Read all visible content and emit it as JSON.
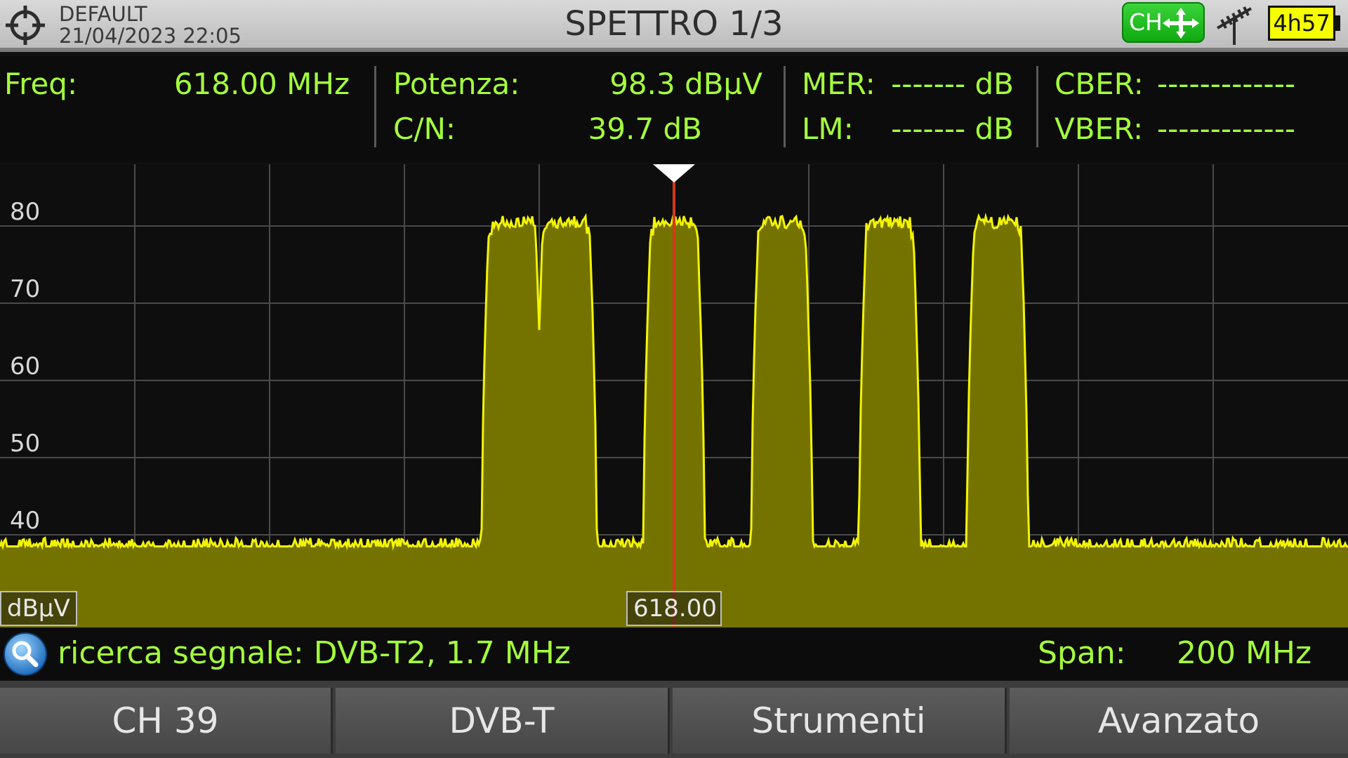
{
  "header": {
    "profile_name": "DEFAULT",
    "datetime": "21/04/2023 22:05",
    "title": "SPETTRO 1/3",
    "ch_label": "CH",
    "battery": "4h57"
  },
  "measures": {
    "freq_label": "Freq:",
    "freq_value": "618.00 MHz",
    "power_label": "Potenza:",
    "power_value": "98.3 dBµV",
    "cn_label": "C/N:",
    "cn_value": "39.7 dB",
    "mer_label": "MER:",
    "mer_value": "------- dB",
    "lm_label": "LM:",
    "lm_value": "------- dB",
    "cber_label": "CBER:",
    "cber_value": "-------------",
    "vber_label": "VBER:",
    "vber_value": "-------------"
  },
  "chart_data": {
    "type": "area",
    "ylabel": "dBµV",
    "yticks": [
      80,
      70,
      60,
      50,
      40
    ],
    "ylim": [
      28,
      88
    ],
    "xlim": [
      518,
      718
    ],
    "x_unit": "MHz",
    "grid": true,
    "marker_frequency": 618.0,
    "marker_label": "618.00",
    "noise_floor": 38.5,
    "channels": [
      {
        "center": 594.0,
        "width": 8,
        "level": 80.5
      },
      {
        "center": 602.0,
        "width": 8,
        "level": 80.5
      },
      {
        "center": 618.0,
        "width": 8,
        "level": 80.5
      },
      {
        "center": 634.0,
        "width": 8,
        "level": 80.5
      },
      {
        "center": 650.0,
        "width": 8,
        "level": 80.5
      },
      {
        "center": 666.0,
        "width": 8,
        "level": 80.5
      }
    ],
    "trace_color": "#f3f500",
    "fill_color": "#757300",
    "marker_color": "#d23a1a"
  },
  "status": {
    "search_text": "ricerca segnale: DVB-T2, 1.7 MHz",
    "span_label": "Span:",
    "span_value": "200 MHz"
  },
  "softkeys": [
    "CH 39",
    "DVB-T",
    "Strumenti",
    "Avanzato"
  ]
}
